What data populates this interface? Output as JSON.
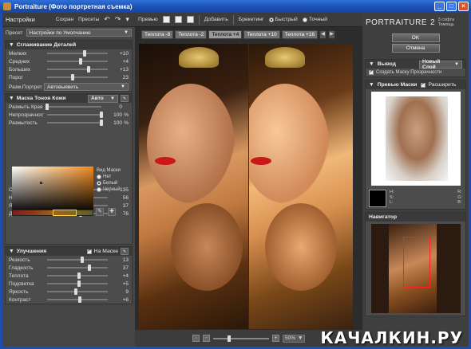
{
  "window": {
    "title": "Portraiture (Фото портретная съемка)",
    "buttons": [
      "_",
      "□",
      "×"
    ]
  },
  "left": {
    "header_title": "Настройки",
    "save_label": "Сохран",
    "presets_label": "Пресеты",
    "preset_label": "Пресет",
    "preset_value": "Настройки по Умолчанию",
    "smoothing": {
      "title": "Сглаживание Деталей",
      "rows": [
        {
          "label": "Мелких",
          "value": "+10",
          "pos": 0.62
        },
        {
          "label": "Средних",
          "value": "+4",
          "pos": 0.55
        },
        {
          "label": "Больших",
          "value": "+13",
          "pos": 0.68
        },
        {
          "label": "Порог",
          "value": "23",
          "pos": 0.42
        }
      ],
      "portrait_label": "Разм.Портрет",
      "portrait_value": "Автовыявить"
    },
    "skinmask": {
      "title": "Маска Тонов Кожи",
      "mode": "Авто",
      "rows": [
        {
          "label": "Размыть Края",
          "value": "0",
          "unit": "",
          "pos": 0.0
        },
        {
          "label": "Непрозрачность",
          "value": "100",
          "unit": "%",
          "pos": 1.0
        },
        {
          "label": "Размытость",
          "value": "100",
          "unit": "%",
          "pos": 1.0
        }
      ],
      "view_title": "Вид Маски",
      "view_options": [
        "Нет",
        "Белый",
        "Черный"
      ],
      "sliders": [
        {
          "label": "Оттенок",
          "value": "135",
          "pos": 0.52
        },
        {
          "label": "Насыщенность",
          "value": "56",
          "pos": 0.45
        },
        {
          "label": "Яркость",
          "value": "37",
          "pos": 0.38
        },
        {
          "label": "Диапазон",
          "value": "76",
          "pos": 0.55
        }
      ]
    },
    "enhance": {
      "title": "Улучшения",
      "mask_check": "На Маске",
      "rows": [
        {
          "label": "Резкость",
          "value": "13",
          "pos": 0.58
        },
        {
          "label": "Гладкость",
          "value": "37",
          "pos": 0.7
        },
        {
          "label": "Теплота",
          "value": "+4",
          "pos": 0.52
        },
        {
          "label": "Подсветка",
          "value": "+5",
          "pos": 0.53
        },
        {
          "label": "Яркость",
          "value": "9",
          "pos": 0.48
        },
        {
          "label": "Контраст",
          "value": "+6",
          "pos": 0.54
        }
      ]
    }
  },
  "center": {
    "preview_label": "Превью",
    "add_label": "Добавить",
    "bracket_label": "Брекетинг",
    "fast_label": "Быстрый",
    "precise_label": "Точный",
    "tabs": [
      "Теплота -8",
      "Теплота -2",
      "Теплота +4",
      "Теплота +10",
      "Теплота +16"
    ],
    "zoom": "50%"
  },
  "right": {
    "brand": "PORTRAITURE",
    "version": "2",
    "company": "3 софта Томощь",
    "ok": "OK",
    "cancel": "Отмена",
    "output_title": "Вывод",
    "output_value": "Новый Слой",
    "transparency_label": "Создать Маску Прозрачности",
    "mask_preview_title": "Превью Маски",
    "expand_label": "Расширить",
    "info_left": [
      "H:",
      "S:",
      "L:"
    ],
    "info_right": [
      "R:",
      "G:",
      "B:"
    ],
    "navigator_title": "Навигатор"
  },
  "watermark": "КАЧАЛКИН.РУ"
}
